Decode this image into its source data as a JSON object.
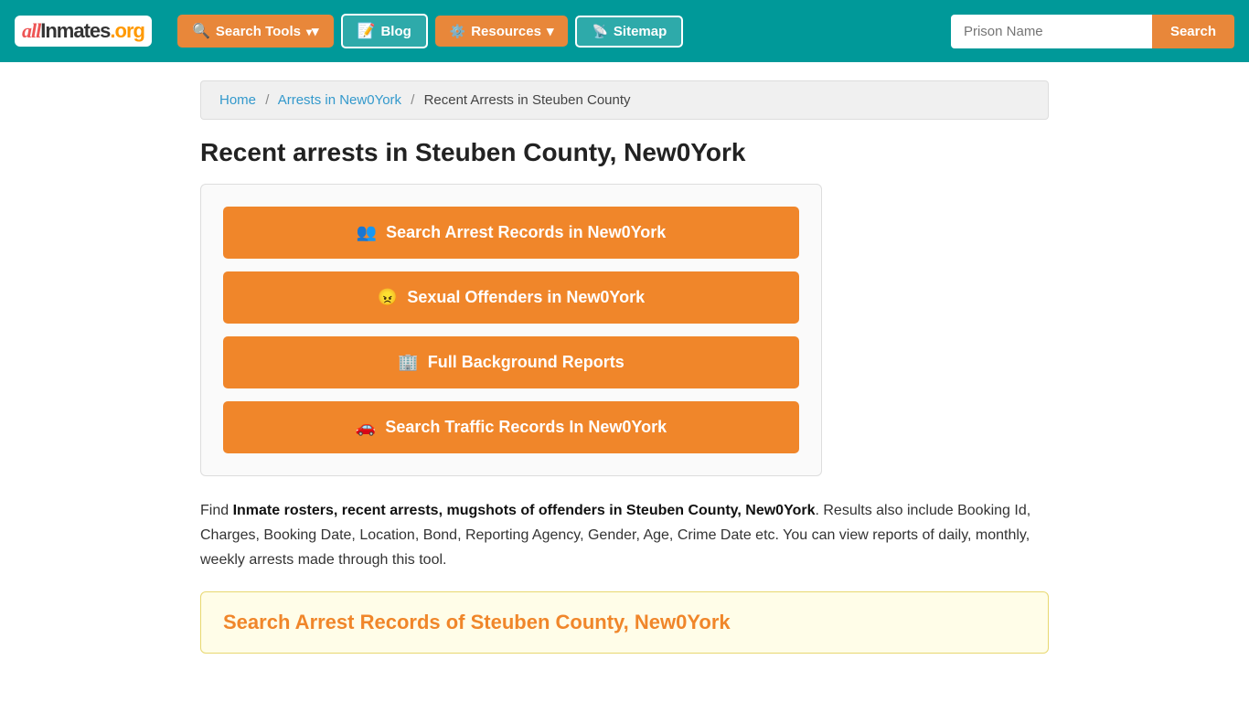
{
  "header": {
    "logo": {
      "text_all": "all",
      "text_inmates": "Inmates",
      "text_org": ".org"
    },
    "nav": {
      "search_tools_label": "Search Tools",
      "blog_label": "Blog",
      "resources_label": "Resources",
      "sitemap_label": "Sitemap"
    },
    "search": {
      "placeholder": "Prison Name",
      "button_label": "Search"
    }
  },
  "breadcrumb": {
    "home": "Home",
    "arrests": "Arrests in New0York",
    "current": "Recent Arrests in Steuben County"
  },
  "main": {
    "page_title": "Recent arrests in Steuben County, New0York",
    "action_buttons": [
      {
        "id": "search-arrest",
        "label": "Search Arrest Records in New0York",
        "icon": "people"
      },
      {
        "id": "sexual-offenders",
        "label": "Sexual Offenders in New0York",
        "icon": "face"
      },
      {
        "id": "background-reports",
        "label": "Full Background Reports",
        "icon": "building"
      },
      {
        "id": "traffic-records",
        "label": "Search Traffic Records In New0York",
        "icon": "car"
      }
    ],
    "description_part1": "Find ",
    "description_bold": "Inmate rosters, recent arrests, mugshots of offenders in Steuben County, New0York",
    "description_part2": ". Results also include Booking Id, Charges, Booking Date, Location, Bond, Reporting Agency, Gender, Age, Crime Date etc. You can view reports of daily, monthly, weekly arrests made through this tool.",
    "search_records_box": {
      "title": "Search Arrest Records of Steuben County, New0York"
    }
  }
}
